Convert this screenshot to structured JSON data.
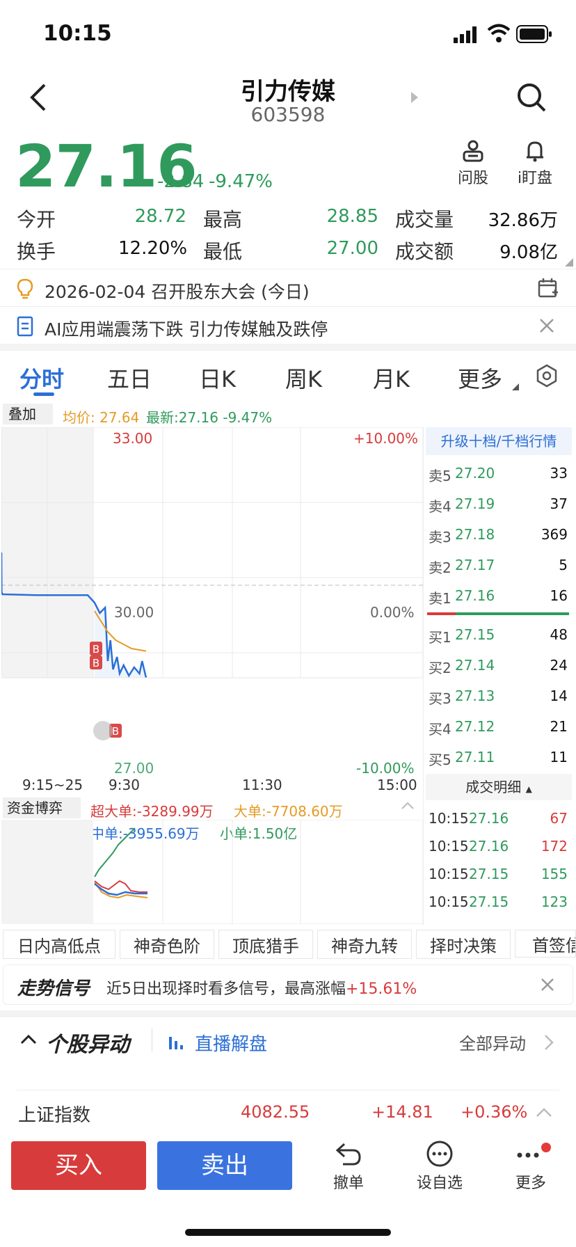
{
  "status": {
    "time": "10:15"
  },
  "header": {
    "name": "引力传媒",
    "code": "603598",
    "ask_label": "问股",
    "watch_label": "i盯盘"
  },
  "quote": {
    "price": "27.16",
    "change": "-2.84",
    "change_pct": "-9.47%",
    "open_label": "今开",
    "open": "28.72",
    "high_label": "最高",
    "high": "28.85",
    "volume_label": "成交量",
    "volume": "32.86万",
    "turnover_label": "换手",
    "turnover": "12.20%",
    "low_label": "最低",
    "low": "27.00",
    "amount_label": "成交额",
    "amount": "9.08亿"
  },
  "notices": [
    {
      "text": "2026-02-04 召开股东大会 (今日)"
    },
    {
      "text": "AI应用端震荡下跌 引力传媒触及跌停"
    }
  ],
  "tabs": [
    {
      "label": "分时",
      "active": true
    },
    {
      "label": "五日"
    },
    {
      "label": "日K"
    },
    {
      "label": "周K"
    },
    {
      "label": "月K"
    },
    {
      "label": "更多"
    }
  ],
  "chart_header": {
    "overlay": "叠加",
    "avg": "均价: 27.64",
    "latest": "最新:27.16 -9.47%"
  },
  "chart_data": {
    "type": "line",
    "y_left_labels": [
      "33.00",
      "30.00",
      "27.00"
    ],
    "y_right_labels": [
      "+10.00%",
      "0.00%",
      "-10.00%"
    ],
    "x_labels": [
      "9:15~25",
      "9:30",
      "11:30",
      "15:00"
    ],
    "ylim": [
      27.0,
      33.0
    ],
    "series": [
      {
        "name": "最新",
        "color": "#2b6fd6",
        "points": [
          [
            0,
            30.0
          ],
          [
            0.2,
            29.05
          ],
          [
            1,
            29.0
          ],
          [
            30,
            28.98
          ],
          [
            60,
            28.98
          ],
          [
            75,
            28.98
          ],
          [
            76,
            28.8
          ],
          [
            80,
            28.55
          ],
          [
            84,
            28.68
          ],
          [
            86,
            27.4
          ],
          [
            88,
            27.9
          ],
          [
            90,
            27.2
          ],
          [
            93,
            27.5
          ],
          [
            95,
            27.1
          ],
          [
            98,
            27.3
          ],
          [
            102,
            27.05
          ],
          [
            106,
            27.25
          ],
          [
            110,
            27.1
          ],
          [
            112,
            27.4
          ],
          [
            115,
            27.0
          ]
        ]
      },
      {
        "name": "均价",
        "color": "#e59b25",
        "points": [
          [
            76,
            28.6
          ],
          [
            80,
            28.4
          ],
          [
            86,
            28.1
          ],
          [
            92,
            27.9
          ],
          [
            98,
            27.8
          ],
          [
            104,
            27.7
          ],
          [
            115,
            27.64
          ]
        ]
      }
    ],
    "markers": [
      "B",
      "B",
      "B"
    ]
  },
  "fund": {
    "label": "资金博弈",
    "super": "超大单:-3289.99万",
    "large": "大单:-7708.60万",
    "medium": "中单:-3955.69万",
    "small": "小单:1.50亿"
  },
  "orderbook": {
    "upgrade": "升级十档/千档行情",
    "sells": [
      {
        "label": "卖5",
        "price": "27.20",
        "qty": "33"
      },
      {
        "label": "卖4",
        "price": "27.19",
        "qty": "37"
      },
      {
        "label": "卖3",
        "price": "27.18",
        "qty": "369"
      },
      {
        "label": "卖2",
        "price": "27.17",
        "qty": "5"
      },
      {
        "label": "卖1",
        "price": "27.16",
        "qty": "16"
      }
    ],
    "buys": [
      {
        "label": "买1",
        "price": "27.15",
        "qty": "48"
      },
      {
        "label": "买2",
        "price": "27.14",
        "qty": "24"
      },
      {
        "label": "买3",
        "price": "27.13",
        "qty": "14"
      },
      {
        "label": "买4",
        "price": "27.12",
        "qty": "21"
      },
      {
        "label": "买5",
        "price": "27.11",
        "qty": "11"
      }
    ],
    "detail_title": "成交明细",
    "trades": [
      {
        "time": "10:15",
        "price": "27.16",
        "qty": "67"
      },
      {
        "time": "10:15",
        "price": "27.16",
        "qty": "172"
      },
      {
        "time": "10:15",
        "price": "27.15",
        "qty": "155"
      },
      {
        "time": "10:15",
        "price": "27.15",
        "qty": "123"
      }
    ]
  },
  "tools": [
    "日内高低点",
    "神奇色阶",
    "顶底猎手",
    "神奇九转",
    "择时决策",
    "首签信"
  ],
  "signal": {
    "title": "走势信号",
    "text": "近5日出现择时看多信号，最高涨幅",
    "pct": "+15.61%"
  },
  "movement": {
    "title": "个股异动",
    "live": "直播解盘",
    "all": "全部异动"
  },
  "index": {
    "name": "上证指数",
    "value": "4082.55",
    "change": "+14.81",
    "pct": "+0.36%"
  },
  "actions": {
    "buy": "买入",
    "sell": "卖出",
    "cancel": "撤单",
    "watch": "设自选",
    "more": "更多"
  }
}
